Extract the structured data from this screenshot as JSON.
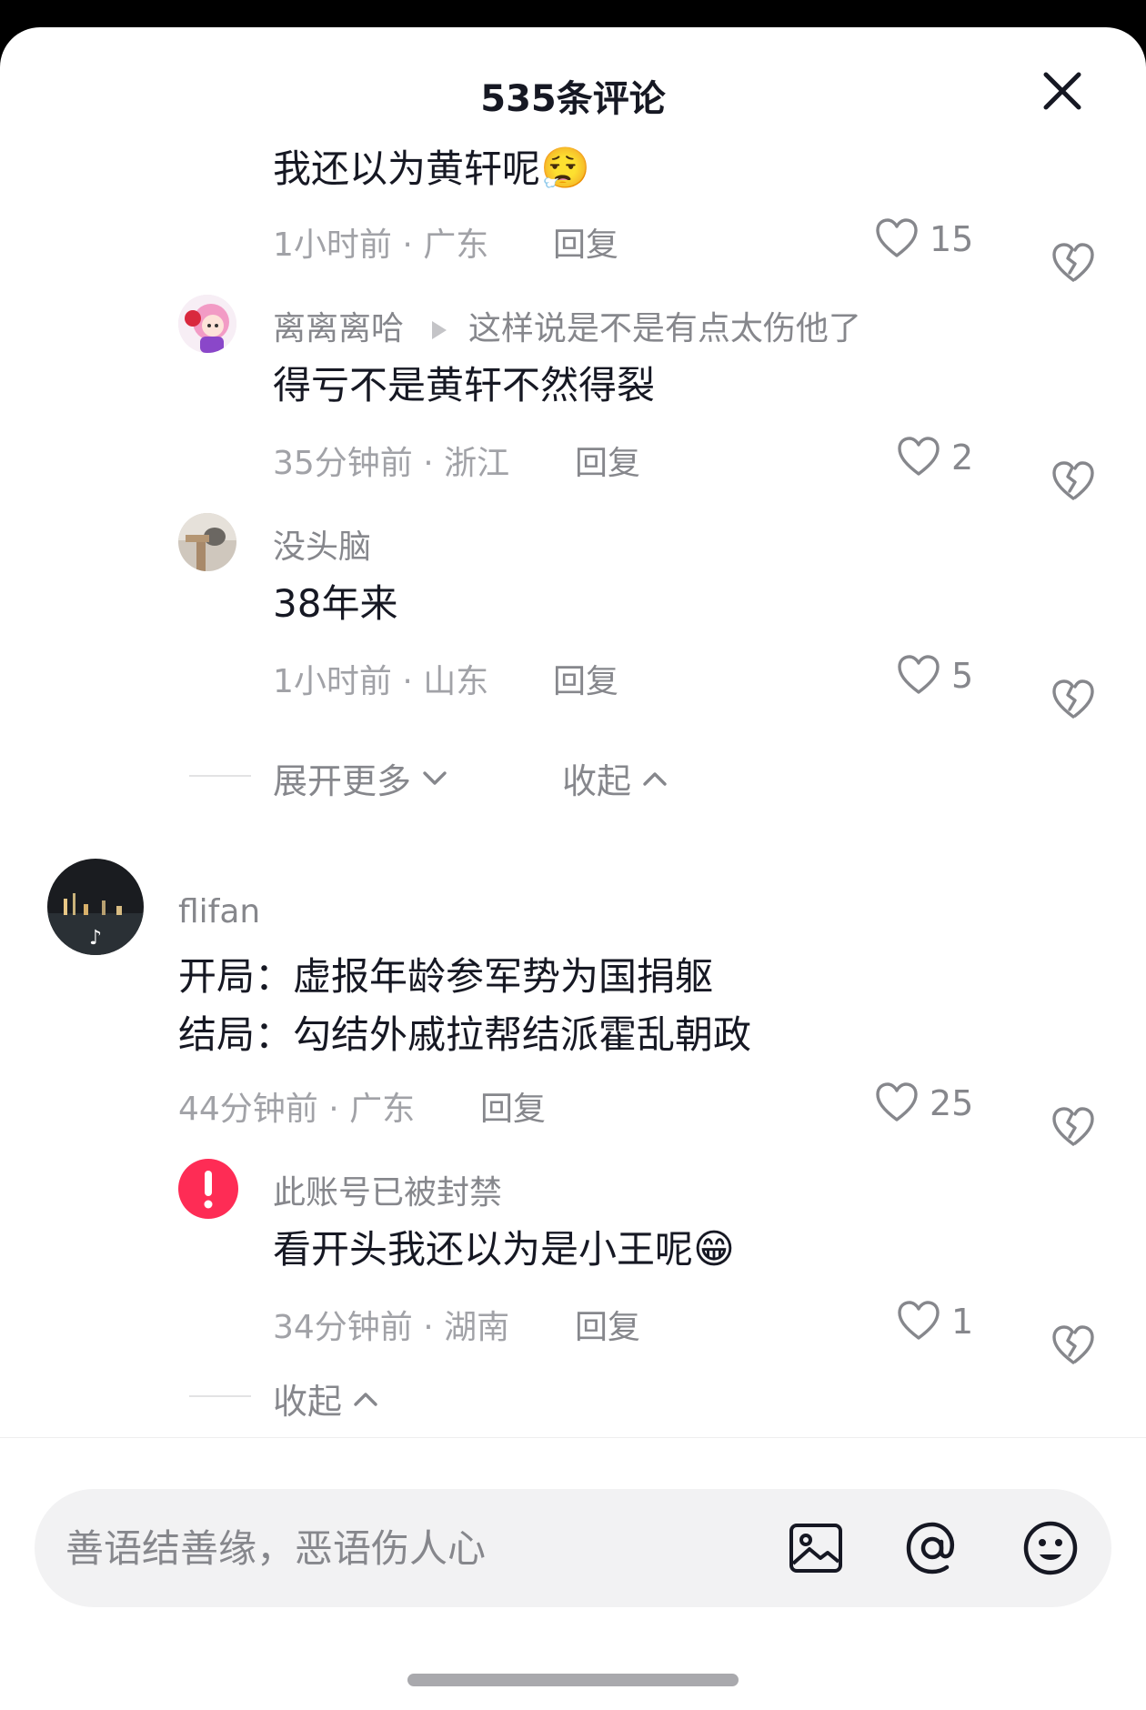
{
  "header": {
    "title": "535条评论"
  },
  "comments": [
    {
      "name": "",
      "text": "我还以为黄轩呢",
      "emoji": "😮‍💨",
      "time_location": "1小时前 · 广东",
      "reply_label": "回复",
      "likes": "15"
    },
    {
      "name": "离离离哈",
      "reply_to": "这样说是不是有点太伤他了",
      "text": "得亏不是黄轩不然得裂",
      "time_location": "35分钟前 · 浙江",
      "reply_label": "回复",
      "likes": "2"
    },
    {
      "name": "没头脑",
      "text": "38年来",
      "time_location": "1小时前 · 山东",
      "reply_label": "回复",
      "likes": "5"
    },
    {
      "name": "flifan",
      "text_line1": "开局：虚报年龄参军势为国捐躯",
      "text_line2": "结局：勾结外戚拉帮结派霍乱朝政",
      "time_location": "44分钟前 · 广东",
      "reply_label": "回复",
      "likes": "25"
    },
    {
      "name": "此账号已被封禁",
      "text": "看开头我还以为是小王呢",
      "emoji": "😁",
      "time_location": "34分钟前 · 湖南",
      "reply_label": "回复",
      "likes": "1"
    }
  ],
  "thread1": {
    "expand_more": "展开更多",
    "collapse": "收起"
  },
  "thread2": {
    "collapse": "收起"
  },
  "input": {
    "placeholder": "善语结善缘，恶语伤人心"
  },
  "colors": {
    "text_primary": "#161823",
    "text_secondary": "#86878c",
    "text_muted": "#a1a2a7",
    "banned_red": "#fe2c55"
  }
}
